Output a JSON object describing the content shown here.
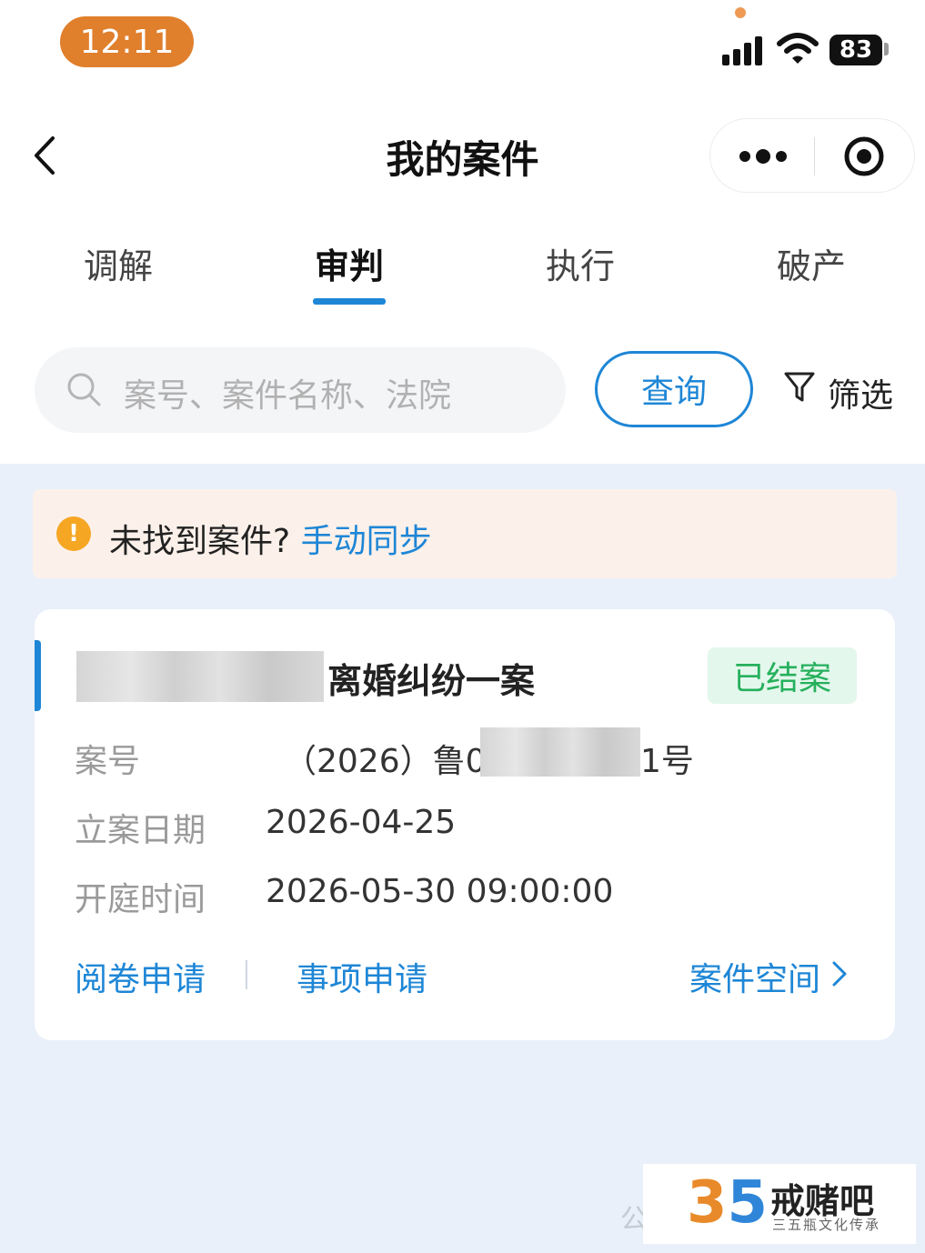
{
  "status_bar": {
    "time": "12:11",
    "battery": "83",
    "accent": "#e07f2c"
  },
  "nav": {
    "title": "我的案件"
  },
  "tabs": [
    {
      "label": "调解"
    },
    {
      "label": "审判",
      "active": true
    },
    {
      "label": "执行"
    },
    {
      "label": "破产"
    }
  ],
  "search": {
    "placeholder": "案号、案件名称、法院",
    "query_label": "查询",
    "filter_label": "筛选"
  },
  "notice": {
    "text": "未找到案件?",
    "link": "手动同步"
  },
  "case": {
    "title_suffix": "离婚纠纷一案",
    "status": "已结案",
    "rows": {
      "case_no_label": "案号",
      "case_no_prefix": "（2026）鲁07",
      "case_no_suffix": "1号",
      "filing_date_label": "立案日期",
      "filing_date": "2026-04-25",
      "hearing_time_label": "开庭时间",
      "hearing_time": "2026-05-30 09:00:00"
    },
    "actions": {
      "review_files": "阅卷申请",
      "matter_apply": "事项申请",
      "case_space": "案件空间"
    }
  },
  "watermark": {
    "text": "公",
    "logo_number_a": "3",
    "logo_number_b": "5",
    "logo_name": "戒赌吧",
    "logo_sub": "三五瓶文化传承"
  },
  "colors": {
    "primary": "#1e86d6",
    "closed_badge": "#25b05c",
    "warning": "#f5a623",
    "background": "#e9f0fa"
  }
}
